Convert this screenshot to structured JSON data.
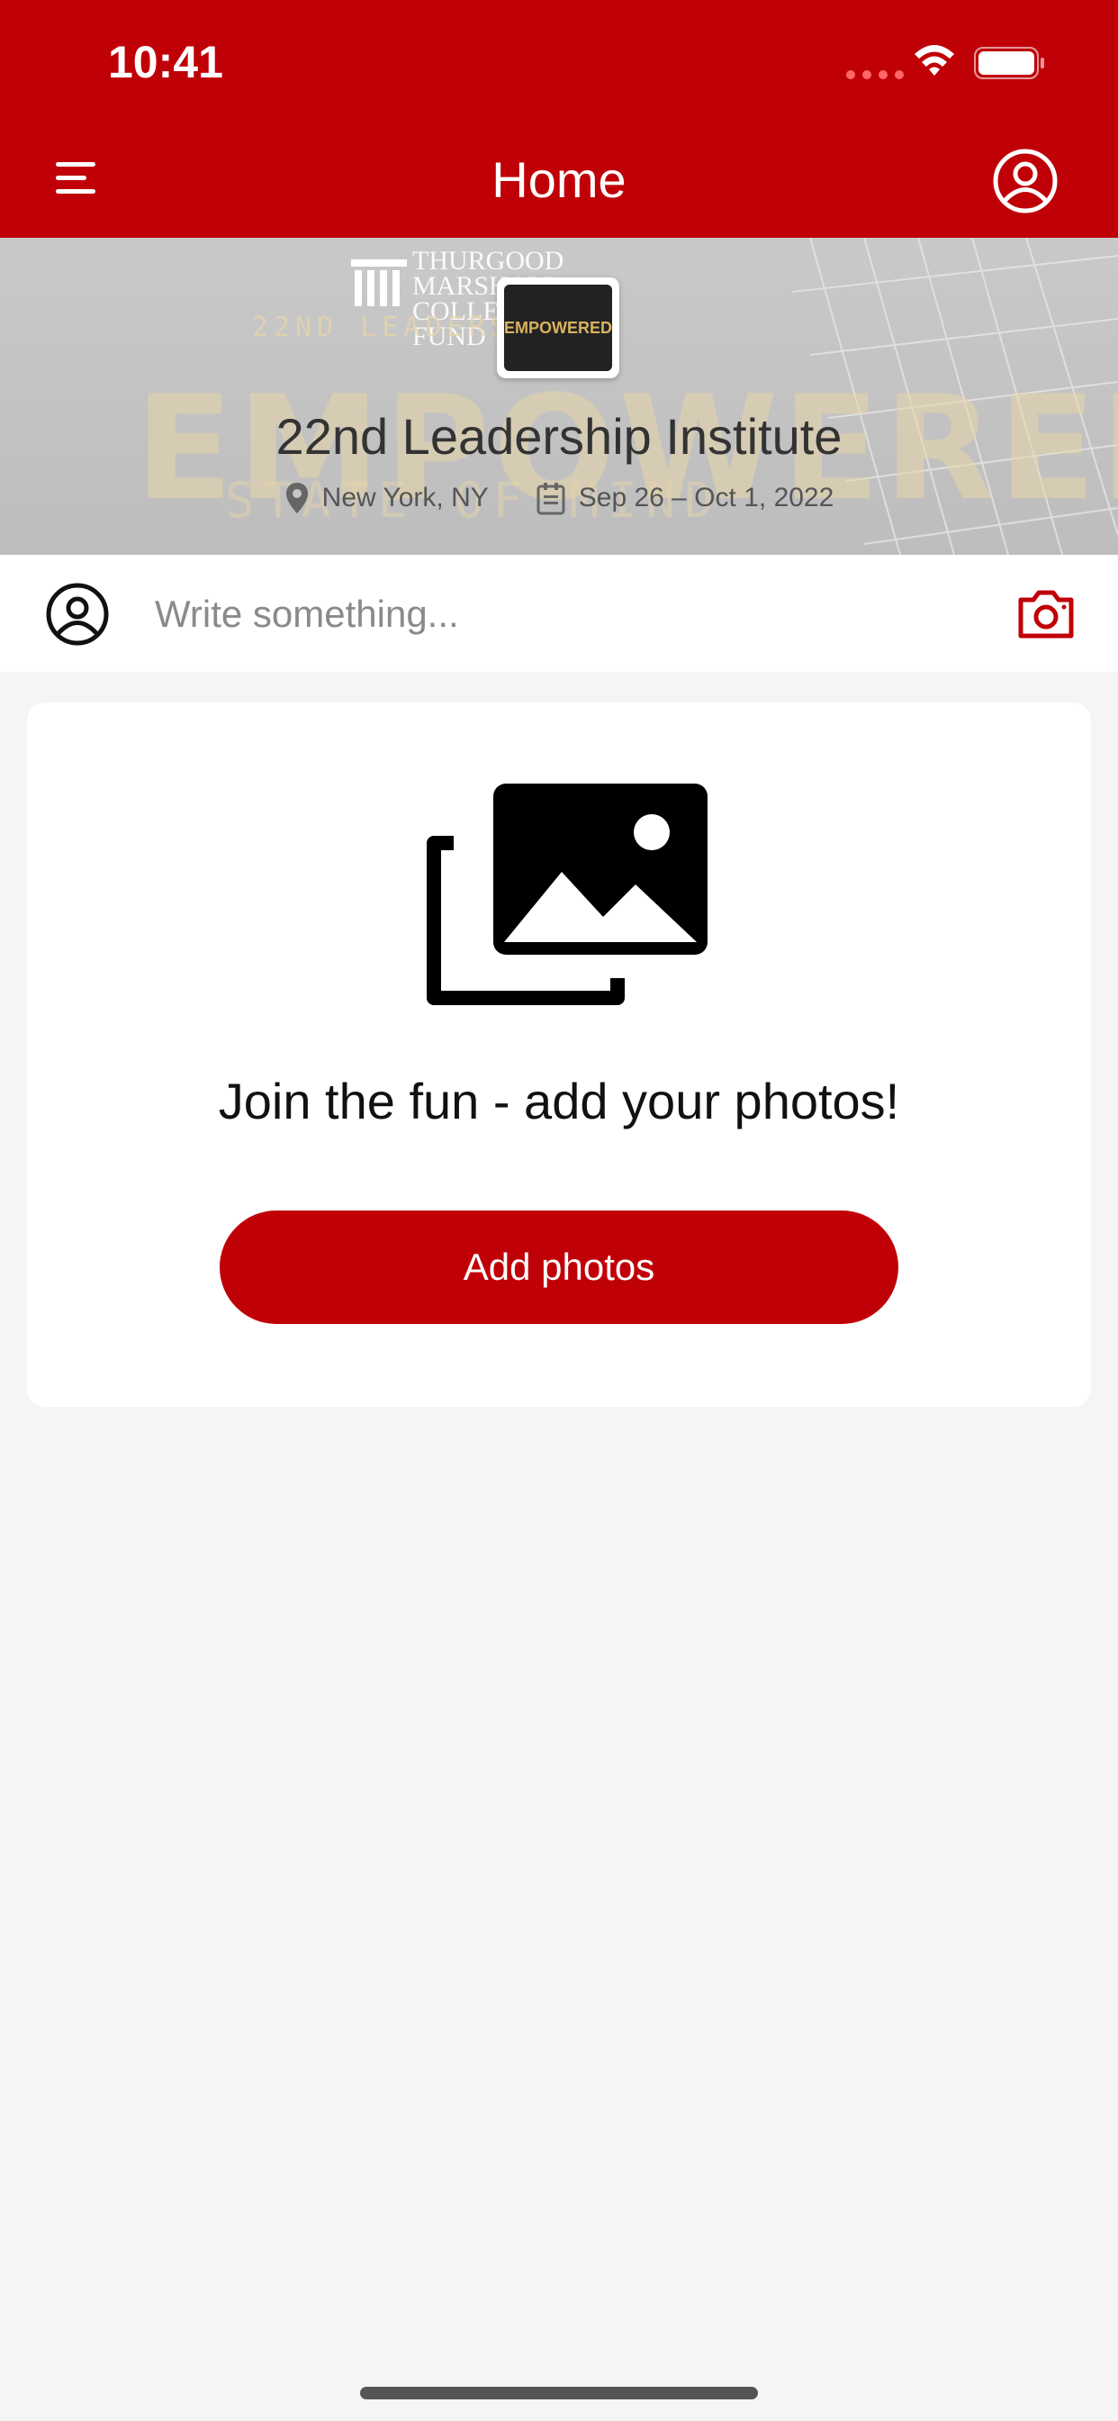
{
  "status_bar": {
    "time": "10:41"
  },
  "header": {
    "title": "Home"
  },
  "banner": {
    "org_logo_text": "THURGOOD MARSHALL COLLEGE FUND",
    "art_main": "EMPOWERED",
    "art_top": "22ND LEADERSHIP",
    "art_bottom": "STATE OF MIND",
    "thumb_text": "EMPOWERED",
    "event_title": "22nd Leadership Institute",
    "location": "New York, NY",
    "dates": "Sep 26 – Oct 1, 2022"
  },
  "composer": {
    "placeholder": "Write something..."
  },
  "empty_state": {
    "headline": "Join the fun - add your photos!",
    "button_label": "Add photos"
  },
  "colors": {
    "brand_red": "#c00007",
    "background": "#f5f5f5"
  }
}
